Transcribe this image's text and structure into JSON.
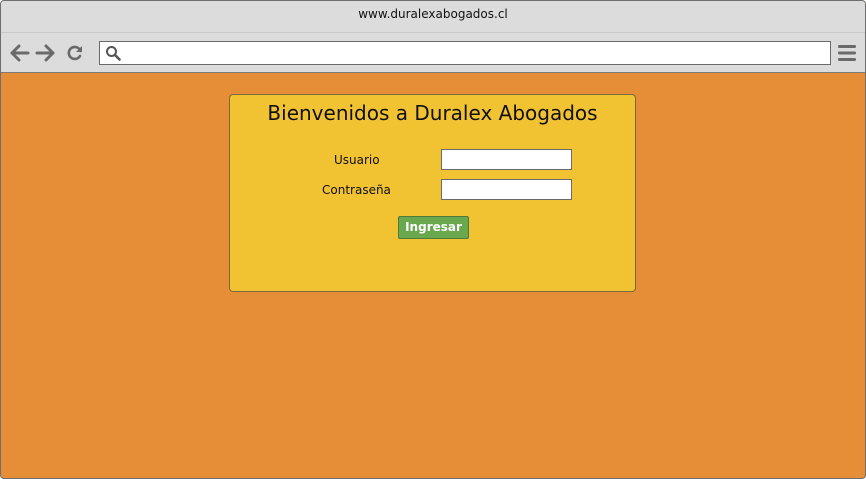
{
  "browser": {
    "window_title": "www.duralexabogados.cl",
    "address_bar": {
      "value": "",
      "placeholder": ""
    },
    "icons": {
      "back": "arrow-left-icon",
      "forward": "arrow-right-icon",
      "reload": "reload-icon",
      "search": "search-icon",
      "menu": "hamburger-menu-icon"
    }
  },
  "login": {
    "title": "Bienvenidos a Duralex Abogados",
    "username_label": "Usuario",
    "username_value": "",
    "password_label": "Contraseña",
    "password_value": "",
    "submit_label": "Ingresar"
  },
  "colors": {
    "page_background": "#e68d37",
    "card_background": "#f1c232",
    "button_background": "#6aa84f",
    "chrome_background": "#dcdcdc"
  }
}
